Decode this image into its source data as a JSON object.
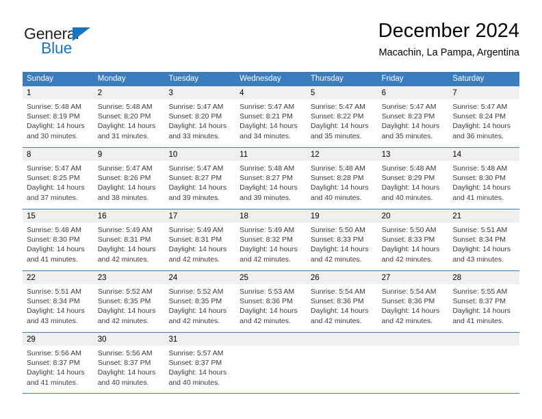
{
  "brand": {
    "name_part1": "General",
    "name_part2": "Blue",
    "triangle_color": "#1b75bb",
    "text_color": "#231f20"
  },
  "header": {
    "title": "December 2024",
    "subtitle": "Macachin, La Pampa, Argentina"
  },
  "theme": {
    "header_band": "#3b7cbf",
    "day_band": "#efefef",
    "body_text": "#3a3a3a"
  },
  "weekdays": [
    "Sunday",
    "Monday",
    "Tuesday",
    "Wednesday",
    "Thursday",
    "Friday",
    "Saturday"
  ],
  "weeks": [
    [
      {
        "day": "1",
        "sunrise": "Sunrise: 5:48 AM",
        "sunset": "Sunset: 8:19 PM",
        "daylight1": "Daylight: 14 hours",
        "daylight2": "and 30 minutes."
      },
      {
        "day": "2",
        "sunrise": "Sunrise: 5:48 AM",
        "sunset": "Sunset: 8:20 PM",
        "daylight1": "Daylight: 14 hours",
        "daylight2": "and 31 minutes."
      },
      {
        "day": "3",
        "sunrise": "Sunrise: 5:47 AM",
        "sunset": "Sunset: 8:20 PM",
        "daylight1": "Daylight: 14 hours",
        "daylight2": "and 33 minutes."
      },
      {
        "day": "4",
        "sunrise": "Sunrise: 5:47 AM",
        "sunset": "Sunset: 8:21 PM",
        "daylight1": "Daylight: 14 hours",
        "daylight2": "and 34 minutes."
      },
      {
        "day": "5",
        "sunrise": "Sunrise: 5:47 AM",
        "sunset": "Sunset: 8:22 PM",
        "daylight1": "Daylight: 14 hours",
        "daylight2": "and 35 minutes."
      },
      {
        "day": "6",
        "sunrise": "Sunrise: 5:47 AM",
        "sunset": "Sunset: 8:23 PM",
        "daylight1": "Daylight: 14 hours",
        "daylight2": "and 35 minutes."
      },
      {
        "day": "7",
        "sunrise": "Sunrise: 5:47 AM",
        "sunset": "Sunset: 8:24 PM",
        "daylight1": "Daylight: 14 hours",
        "daylight2": "and 36 minutes."
      }
    ],
    [
      {
        "day": "8",
        "sunrise": "Sunrise: 5:47 AM",
        "sunset": "Sunset: 8:25 PM",
        "daylight1": "Daylight: 14 hours",
        "daylight2": "and 37 minutes."
      },
      {
        "day": "9",
        "sunrise": "Sunrise: 5:47 AM",
        "sunset": "Sunset: 8:26 PM",
        "daylight1": "Daylight: 14 hours",
        "daylight2": "and 38 minutes."
      },
      {
        "day": "10",
        "sunrise": "Sunrise: 5:47 AM",
        "sunset": "Sunset: 8:27 PM",
        "daylight1": "Daylight: 14 hours",
        "daylight2": "and 39 minutes."
      },
      {
        "day": "11",
        "sunrise": "Sunrise: 5:48 AM",
        "sunset": "Sunset: 8:27 PM",
        "daylight1": "Daylight: 14 hours",
        "daylight2": "and 39 minutes."
      },
      {
        "day": "12",
        "sunrise": "Sunrise: 5:48 AM",
        "sunset": "Sunset: 8:28 PM",
        "daylight1": "Daylight: 14 hours",
        "daylight2": "and 40 minutes."
      },
      {
        "day": "13",
        "sunrise": "Sunrise: 5:48 AM",
        "sunset": "Sunset: 8:29 PM",
        "daylight1": "Daylight: 14 hours",
        "daylight2": "and 40 minutes."
      },
      {
        "day": "14",
        "sunrise": "Sunrise: 5:48 AM",
        "sunset": "Sunset: 8:30 PM",
        "daylight1": "Daylight: 14 hours",
        "daylight2": "and 41 minutes."
      }
    ],
    [
      {
        "day": "15",
        "sunrise": "Sunrise: 5:48 AM",
        "sunset": "Sunset: 8:30 PM",
        "daylight1": "Daylight: 14 hours",
        "daylight2": "and 41 minutes."
      },
      {
        "day": "16",
        "sunrise": "Sunrise: 5:49 AM",
        "sunset": "Sunset: 8:31 PM",
        "daylight1": "Daylight: 14 hours",
        "daylight2": "and 42 minutes."
      },
      {
        "day": "17",
        "sunrise": "Sunrise: 5:49 AM",
        "sunset": "Sunset: 8:31 PM",
        "daylight1": "Daylight: 14 hours",
        "daylight2": "and 42 minutes."
      },
      {
        "day": "18",
        "sunrise": "Sunrise: 5:49 AM",
        "sunset": "Sunset: 8:32 PM",
        "daylight1": "Daylight: 14 hours",
        "daylight2": "and 42 minutes."
      },
      {
        "day": "19",
        "sunrise": "Sunrise: 5:50 AM",
        "sunset": "Sunset: 8:33 PM",
        "daylight1": "Daylight: 14 hours",
        "daylight2": "and 42 minutes."
      },
      {
        "day": "20",
        "sunrise": "Sunrise: 5:50 AM",
        "sunset": "Sunset: 8:33 PM",
        "daylight1": "Daylight: 14 hours",
        "daylight2": "and 42 minutes."
      },
      {
        "day": "21",
        "sunrise": "Sunrise: 5:51 AM",
        "sunset": "Sunset: 8:34 PM",
        "daylight1": "Daylight: 14 hours",
        "daylight2": "and 43 minutes."
      }
    ],
    [
      {
        "day": "22",
        "sunrise": "Sunrise: 5:51 AM",
        "sunset": "Sunset: 8:34 PM",
        "daylight1": "Daylight: 14 hours",
        "daylight2": "and 43 minutes."
      },
      {
        "day": "23",
        "sunrise": "Sunrise: 5:52 AM",
        "sunset": "Sunset: 8:35 PM",
        "daylight1": "Daylight: 14 hours",
        "daylight2": "and 42 minutes."
      },
      {
        "day": "24",
        "sunrise": "Sunrise: 5:52 AM",
        "sunset": "Sunset: 8:35 PM",
        "daylight1": "Daylight: 14 hours",
        "daylight2": "and 42 minutes."
      },
      {
        "day": "25",
        "sunrise": "Sunrise: 5:53 AM",
        "sunset": "Sunset: 8:36 PM",
        "daylight1": "Daylight: 14 hours",
        "daylight2": "and 42 minutes."
      },
      {
        "day": "26",
        "sunrise": "Sunrise: 5:54 AM",
        "sunset": "Sunset: 8:36 PM",
        "daylight1": "Daylight: 14 hours",
        "daylight2": "and 42 minutes."
      },
      {
        "day": "27",
        "sunrise": "Sunrise: 5:54 AM",
        "sunset": "Sunset: 8:36 PM",
        "daylight1": "Daylight: 14 hours",
        "daylight2": "and 42 minutes."
      },
      {
        "day": "28",
        "sunrise": "Sunrise: 5:55 AM",
        "sunset": "Sunset: 8:37 PM",
        "daylight1": "Daylight: 14 hours",
        "daylight2": "and 41 minutes."
      }
    ],
    [
      {
        "day": "29",
        "sunrise": "Sunrise: 5:56 AM",
        "sunset": "Sunset: 8:37 PM",
        "daylight1": "Daylight: 14 hours",
        "daylight2": "and 41 minutes."
      },
      {
        "day": "30",
        "sunrise": "Sunrise: 5:56 AM",
        "sunset": "Sunset: 8:37 PM",
        "daylight1": "Daylight: 14 hours",
        "daylight2": "and 40 minutes."
      },
      {
        "day": "31",
        "sunrise": "Sunrise: 5:57 AM",
        "sunset": "Sunset: 8:37 PM",
        "daylight1": "Daylight: 14 hours",
        "daylight2": "and 40 minutes."
      },
      {
        "day": "",
        "sunrise": "",
        "sunset": "",
        "daylight1": "",
        "daylight2": ""
      },
      {
        "day": "",
        "sunrise": "",
        "sunset": "",
        "daylight1": "",
        "daylight2": ""
      },
      {
        "day": "",
        "sunrise": "",
        "sunset": "",
        "daylight1": "",
        "daylight2": ""
      },
      {
        "day": "",
        "sunrise": "",
        "sunset": "",
        "daylight1": "",
        "daylight2": ""
      }
    ]
  ]
}
